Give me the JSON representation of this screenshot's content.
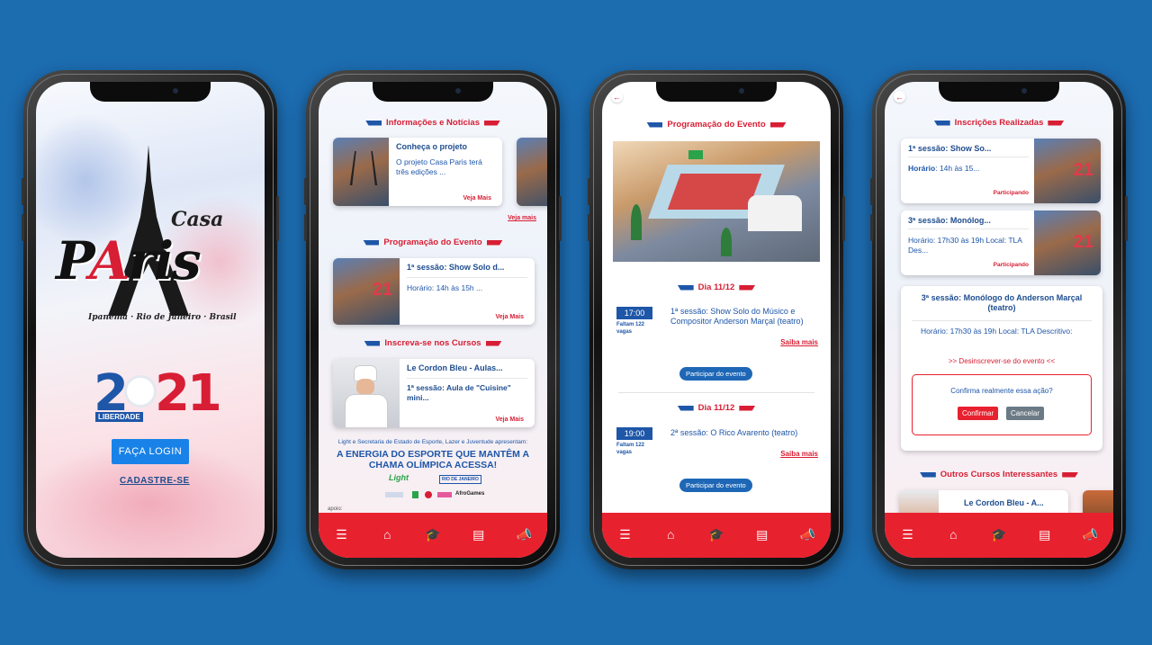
{
  "splash": {
    "casa": "Casa",
    "paris_left": "P",
    "paris_mid": "A",
    "paris_right": "ris",
    "place": "Ipanema · Rio de Janeiro · Brasil",
    "year_a": "2",
    "year_b": "21",
    "liberdade": "LIBERDADE",
    "login_label": "FAÇA LOGIN",
    "signup_label": "CADASTRE-SE"
  },
  "home": {
    "news_header": "Informações e Notícias",
    "news_card": {
      "title": "Conheça o projeto",
      "text": "O projeto Casa Paris terá três edições ...",
      "more": "Veja Mais"
    },
    "news_see_more": "Veja mais",
    "program_header": "Programação do Evento",
    "program_card": {
      "title": "1ª sessão: Show Solo d...",
      "text": "Horário: 14h às 15h ...",
      "more": "Veja Mais"
    },
    "courses_header": "Inscreva-se nos Cursos",
    "course_card": {
      "title": "Le Cordon Bleu - Aulas...",
      "text": "1ª sessão: Aula de \"Cuisine\" mini...",
      "more": "Veja Mais"
    },
    "sponsor_line": "Light e Secretaria de Estado de Esporte, Lazer e Juventude apresentam:",
    "sponsor_headline": "A ENERGIA DO ESPORTE QUE MANTÊM A CHAMA OLÍMPICA ACESSA!",
    "light_logo": "Light",
    "gov_logo": "RIO DE JANEIRO",
    "afro_logo": "AfroGames",
    "apoio": "apoio:"
  },
  "program": {
    "header": "Programação do Evento",
    "day1": "Dia 11/12",
    "event1": {
      "time": "17:00",
      "remaining": "Faltam 122 vagas",
      "title": "1ª sessão: Show Solo do Músico e Compositor Anderson Marçal (teatro)",
      "more": "Saiba mais",
      "cta": "Participar do evento"
    },
    "day2": "Dia 11/12",
    "event2": {
      "time": "19:00",
      "remaining": "Faltam 122 vagas",
      "title": "2ª sessão: O Rico Avarento (teatro)",
      "more": "Saiba mais",
      "cta": "Participar do evento"
    }
  },
  "registrations": {
    "header": "Inscrições Realizadas",
    "reg1": {
      "title": "1ª sessão: Show So...",
      "label": "Horário",
      "time": ": 14h às 15...",
      "status": "Participando"
    },
    "reg2": {
      "title": "3ª sessão: Monólog...",
      "text": "Horário: 17h30 às 19h Local: TLA Des...",
      "status": "Participando"
    },
    "detail": {
      "title": "3ª sessão: Monólogo do Anderson Marçal (teatro)",
      "text": "Horário: 17h30 às 19h Local: TLA Descritivo:",
      "unsubscribe": ">> Desinscrever-se do evento <<"
    },
    "confirm": {
      "question": "Confirma realmente essa ação?",
      "yes": "Confirmar",
      "no": "Cancelar"
    },
    "other_header": "Outros Cursos Interessantes",
    "other_card": {
      "title": "Le Cordon Bleu - A..."
    }
  },
  "tabs": {
    "menu": "☰",
    "home": "⌂",
    "courses": "🎓",
    "book": "▤",
    "announce": "📣"
  },
  "colors": {
    "background": "#1c6cb0",
    "accent_red": "#e8212f",
    "accent_blue": "#1e56a8",
    "button_blue": "#1982e8"
  }
}
